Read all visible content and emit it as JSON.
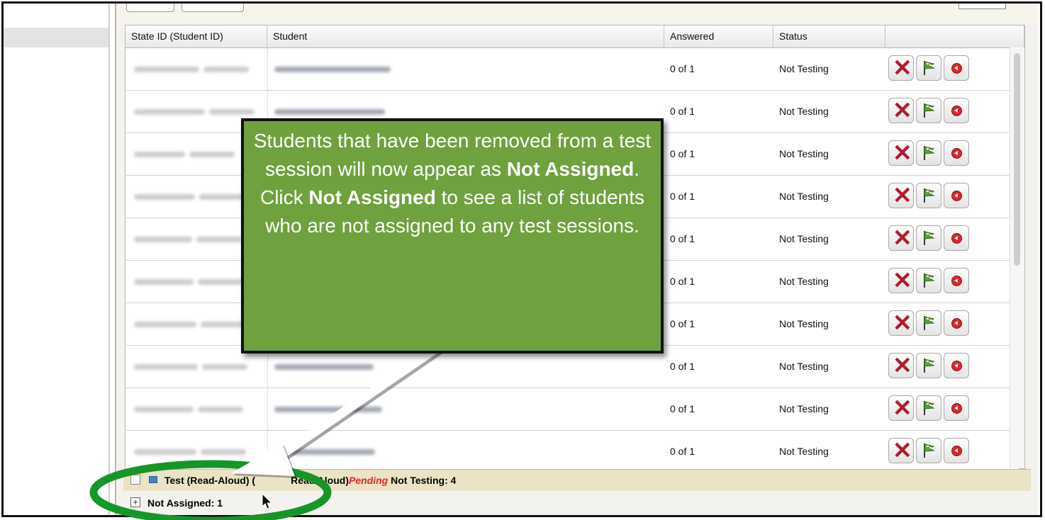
{
  "grid": {
    "columns": [
      "State ID (Student ID)",
      "Student",
      "Answered",
      "Status",
      ""
    ],
    "rows": [
      {
        "answered": "0 of 1",
        "status": "Not Testing"
      },
      {
        "answered": "0 of 1",
        "status": "Not Testing"
      },
      {
        "answered": "0 of 1",
        "status": "Not Testing"
      },
      {
        "answered": "0 of 1",
        "status": "Not Testing"
      },
      {
        "answered": "0 of 1",
        "status": "Not Testing"
      },
      {
        "answered": "0 of 1",
        "status": "Not Testing"
      },
      {
        "answered": "0 of 1",
        "status": "Not Testing"
      },
      {
        "answered": "0 of 1",
        "status": "Not Testing"
      },
      {
        "answered": "0 of 1",
        "status": "Not Testing"
      },
      {
        "answered": "0 of 1",
        "status": "Not Testing"
      }
    ]
  },
  "group_row": {
    "prefix": "Test (Read-Aloud) (",
    "hidden_mid": "",
    "suffix": "Read Aloud)",
    "pending": "Pending",
    "status": "Not Testing: 4"
  },
  "not_assigned": {
    "plus": "+",
    "label": "Not Assigned: 1"
  },
  "callout": {
    "l1": "Students that have been removed from a test session will now appear as ",
    "b1": "Not Assigned",
    "l2": ". Click ",
    "b2": "Not Assigned",
    "l3": " to see a list of students who are not assigned to any test sessions."
  },
  "colors": {
    "callout_bg": "#6fa13e",
    "highlight_ring": "#169629",
    "pending_red": "#e8262b",
    "remove_x": "#b31a2e"
  },
  "icons": [
    "remove-x-icon",
    "checkered-flag-icon",
    "record-back-icon",
    "cursor-arrow-icon",
    "expand-plus-icon"
  ]
}
